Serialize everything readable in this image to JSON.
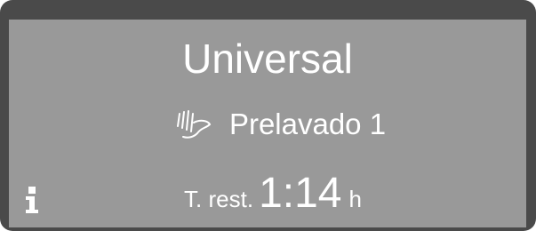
{
  "display": {
    "program_name": "Universal",
    "phase_label": "Prelavado 1",
    "time_prefix": "T. rest.",
    "time_value": "1:14",
    "time_unit": "h"
  },
  "icons": {
    "phase_icon": "prewash-icon",
    "info_icon": "info-icon"
  },
  "colors": {
    "frame": "#4a4a4a",
    "screen": "#999999",
    "text": "#ffffff"
  }
}
